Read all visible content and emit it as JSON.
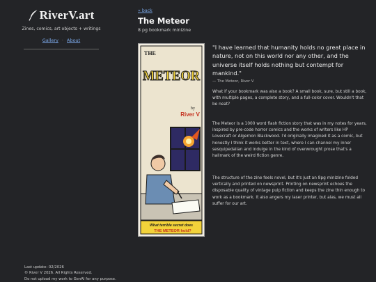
{
  "site": {
    "name": "RiverV.art",
    "tagline": "Zines, comics, art objects + writings",
    "nav": [
      "Gallery",
      "About"
    ]
  },
  "page": {
    "back": "« back",
    "title": "The Meteor",
    "subtitle": "8 pg bookmark minizine"
  },
  "cover": {
    "title_top": "THE",
    "title": "METEOR",
    "by": "by",
    "author": "River V",
    "question": "What terrible secret does",
    "question_line2": "THE METEOR hold?"
  },
  "quote": {
    "text": "\"I have learned that humanity holds no great place in nature, not on this world nor any other, and the universe itself holds nothing but contempt for mankind.\"",
    "credit": "— The Meteor, River V"
  },
  "paragraphs": [
    "What if your bookmark was also a book? A small book, sure, but still a book, with multiple pages, a complete story, and a full-color cover. Wouldn't that be neat?",
    "The Meteor is a 1000 word flash fiction story that was in my notes for years, inspired by pre-code horror comics and the works of writers like HP Lovecraft or Algernon Blackwood. I'd originally imagined it as a comic, but honestly I think it works better in text, where I can channel my inner sesquipedalian and indulge in the kind of overwrought prose that's a hallmark of the weird fiction genre.",
    "The structure of the zine feels novel, but it's just an 8pg minizine folded vertically and printed on newsprint. Printing on newsprint echoes the disposable quality of vintage pulp fiction and keeps the zine thin enough to work as a bookmark. It also angers my laser printer, but alas, we must all suffer for our art."
  ],
  "footer": {
    "updated": "Last update: 02/2026",
    "copyright": "© River V 2026. All Rights Reserved.",
    "notice": "Do not upload my work to GenAI for any purpose."
  },
  "colors": {
    "background": "#232427",
    "link": "#7aa7e6",
    "cover_yellow": "#f2d23a",
    "cover_purple": "#2e2a63"
  }
}
